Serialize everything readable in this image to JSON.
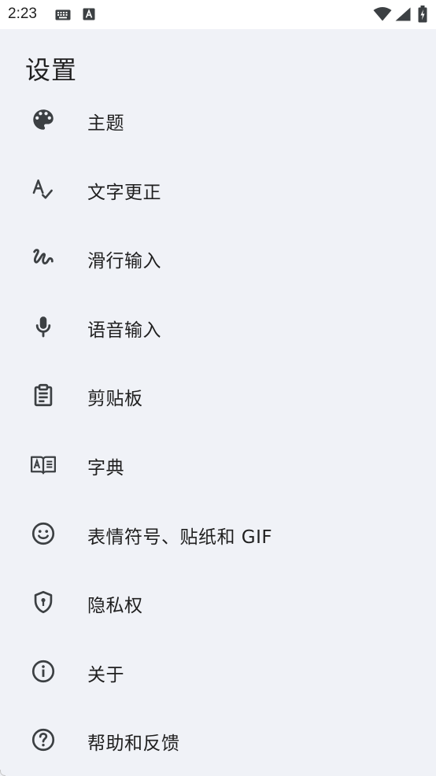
{
  "status_bar": {
    "time": "2:23",
    "icons": [
      "keyboard-icon",
      "a-notification-icon",
      "wifi-icon",
      "cellular-signal-icon",
      "battery-icon"
    ]
  },
  "page": {
    "title": "设置"
  },
  "settings": {
    "items": [
      {
        "label": "主题",
        "icon": "palette-icon"
      },
      {
        "label": "文字更正",
        "icon": "spellcheck-icon"
      },
      {
        "label": "滑行输入",
        "icon": "gesture-icon"
      },
      {
        "label": "语音输入",
        "icon": "microphone-icon"
      },
      {
        "label": "剪贴板",
        "icon": "clipboard-icon"
      },
      {
        "label": "字典",
        "icon": "dictionary-icon"
      },
      {
        "label": "表情符号、贴纸和 GIF",
        "icon": "emoji-icon"
      },
      {
        "label": "隐私权",
        "icon": "shield-icon"
      },
      {
        "label": "关于",
        "icon": "info-icon"
      },
      {
        "label": "帮助和反馈",
        "icon": "help-icon"
      }
    ]
  },
  "colors": {
    "background": "#f0f2f7",
    "status_bar": "#ffffff",
    "text": "#1f1f1f",
    "icon": "#3c4043"
  }
}
